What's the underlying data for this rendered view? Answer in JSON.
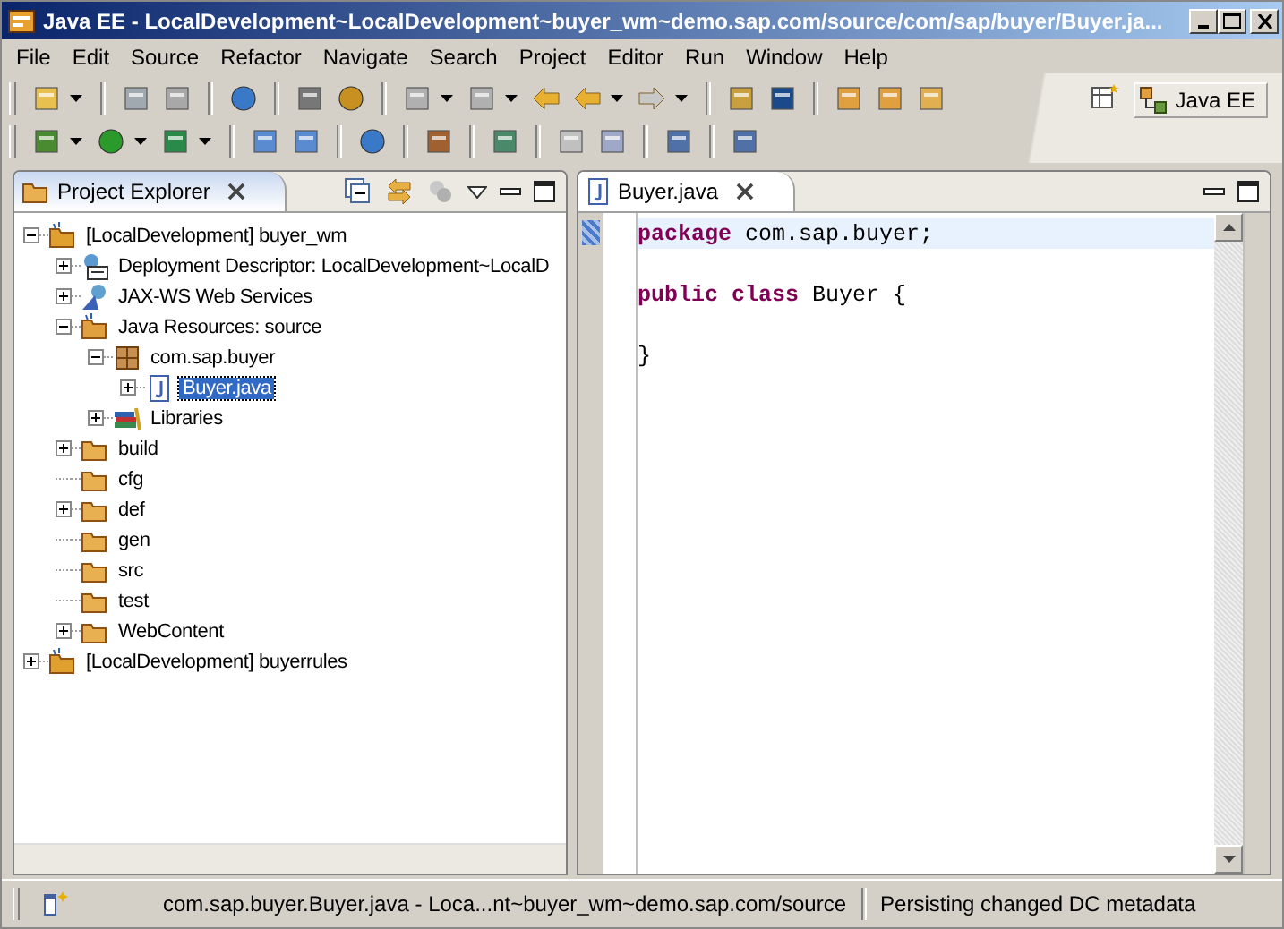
{
  "window": {
    "title": "Java EE - LocalDevelopment~LocalDevelopment~buyer_wm~demo.sap.com/source/com/sap/buyer/Buyer.ja..."
  },
  "menu": [
    "File",
    "Edit",
    "Source",
    "Refactor",
    "Navigate",
    "Search",
    "Project",
    "Editor",
    "Run",
    "Window",
    "Help"
  ],
  "perspective": {
    "label": "Java EE",
    "selected": true
  },
  "explorer": {
    "title": "Project Explorer",
    "tree": [
      {
        "label": "[LocalDevelopment] buyer_wm",
        "kind": "project",
        "expanded": true,
        "children": [
          {
            "label": "Deployment Descriptor: LocalDevelopment~LocalD",
            "kind": "descriptor",
            "expanded": false
          },
          {
            "label": "JAX-WS Web Services",
            "kind": "webservice",
            "expanded": false
          },
          {
            "label": "Java Resources: source",
            "kind": "javares",
            "expanded": true,
            "children": [
              {
                "label": "com.sap.buyer",
                "kind": "package",
                "expanded": true,
                "children": [
                  {
                    "label": "Buyer.java",
                    "kind": "javafile",
                    "expanded": false,
                    "selected": true
                  }
                ]
              },
              {
                "label": "Libraries",
                "kind": "library",
                "expanded": false
              }
            ]
          },
          {
            "label": "build",
            "kind": "folder",
            "expanded": false
          },
          {
            "label": "cfg",
            "kind": "folder"
          },
          {
            "label": "def",
            "kind": "folder",
            "expanded": false
          },
          {
            "label": "gen",
            "kind": "folder"
          },
          {
            "label": "src",
            "kind": "folder"
          },
          {
            "label": "test",
            "kind": "folder"
          },
          {
            "label": "WebContent",
            "kind": "folder",
            "expanded": false
          }
        ]
      },
      {
        "label": "[LocalDevelopment] buyerrules",
        "kind": "project",
        "expanded": false
      }
    ]
  },
  "editor": {
    "tab": "Buyer.java",
    "lines": [
      {
        "current": true,
        "tokens": [
          {
            "text": "package",
            "kind": "keyword"
          },
          {
            "text": " com.sap.buyer;",
            "kind": "plain"
          }
        ]
      },
      {
        "current": false
      },
      {
        "current": false,
        "tokens": [
          {
            "text": "public class",
            "kind": "keyword"
          },
          {
            "text": " Buyer {",
            "kind": "plain"
          }
        ]
      },
      {
        "current": false
      },
      {
        "current": false,
        "tokens": [
          {
            "text": "}",
            "kind": "plain"
          }
        ]
      }
    ]
  },
  "status_bar": {
    "path": "com.sap.buyer.Buyer.java - Loca...nt~buyer_wm~demo.sap.com/source",
    "message": "Persisting changed DC metadata"
  }
}
